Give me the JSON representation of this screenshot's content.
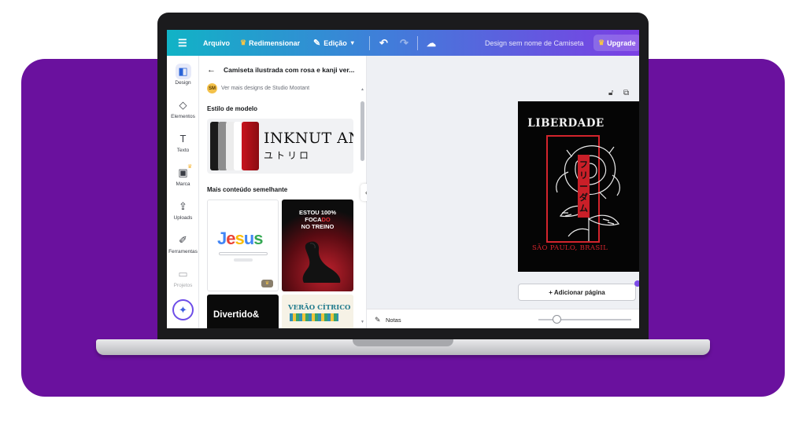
{
  "colors": {
    "accent": "#6a119e",
    "topbar_start": "#11b3c6",
    "topbar_end": "#7b3fe4",
    "brand_red": "#d3242c"
  },
  "topbar": {
    "menu_icon": "hamburger-icon",
    "file_label": "Arquivo",
    "resize_label": "Redimensionar",
    "edit_label": "Edição",
    "doc_name": "Design sem nome de Camiseta",
    "upgrade_label": "Upgrade"
  },
  "rail": {
    "items": [
      {
        "label": "Design",
        "icon": "design-icon"
      },
      {
        "label": "Elementos",
        "icon": "shapes-icon"
      },
      {
        "label": "Texto",
        "icon": "text-icon"
      },
      {
        "label": "Marca",
        "icon": "brand-icon"
      },
      {
        "label": "Uploads",
        "icon": "upload-icon"
      },
      {
        "label": "Ferramentas",
        "icon": "tools-icon"
      },
      {
        "label": "Projetos",
        "icon": "folder-icon"
      }
    ]
  },
  "panel": {
    "title": "Camiseta ilustrada com rosa e kanji ver...",
    "author_initials": "SM",
    "author_link": "Ver mais designs de Studio Mootant",
    "style_heading": "Estilo de modelo",
    "style_font_sample": "INKNUT AN",
    "style_kana_sample": "ユトリロ",
    "similar_heading": "Mais conteúdo semelhante",
    "thumbs": {
      "jesus_word": [
        "J",
        "e",
        "s",
        "u",
        "s"
      ],
      "seal_lines": [
        "ESTOU 100%",
        "FOCADO",
        "NO TREINO"
      ],
      "seal_focado_black": "FOCA",
      "seal_focado_red": "DO",
      "divertido": "Divertido&",
      "verao": "VERÃO CÍTRICO"
    }
  },
  "canvas": {
    "artboard_title": "LIBERDADE",
    "artboard_kana": "フリーダム",
    "artboard_subtitle": "SÃO PAULO, BRASIL",
    "add_page_label": "+ Adicionar página",
    "notes_label": "Notas"
  }
}
